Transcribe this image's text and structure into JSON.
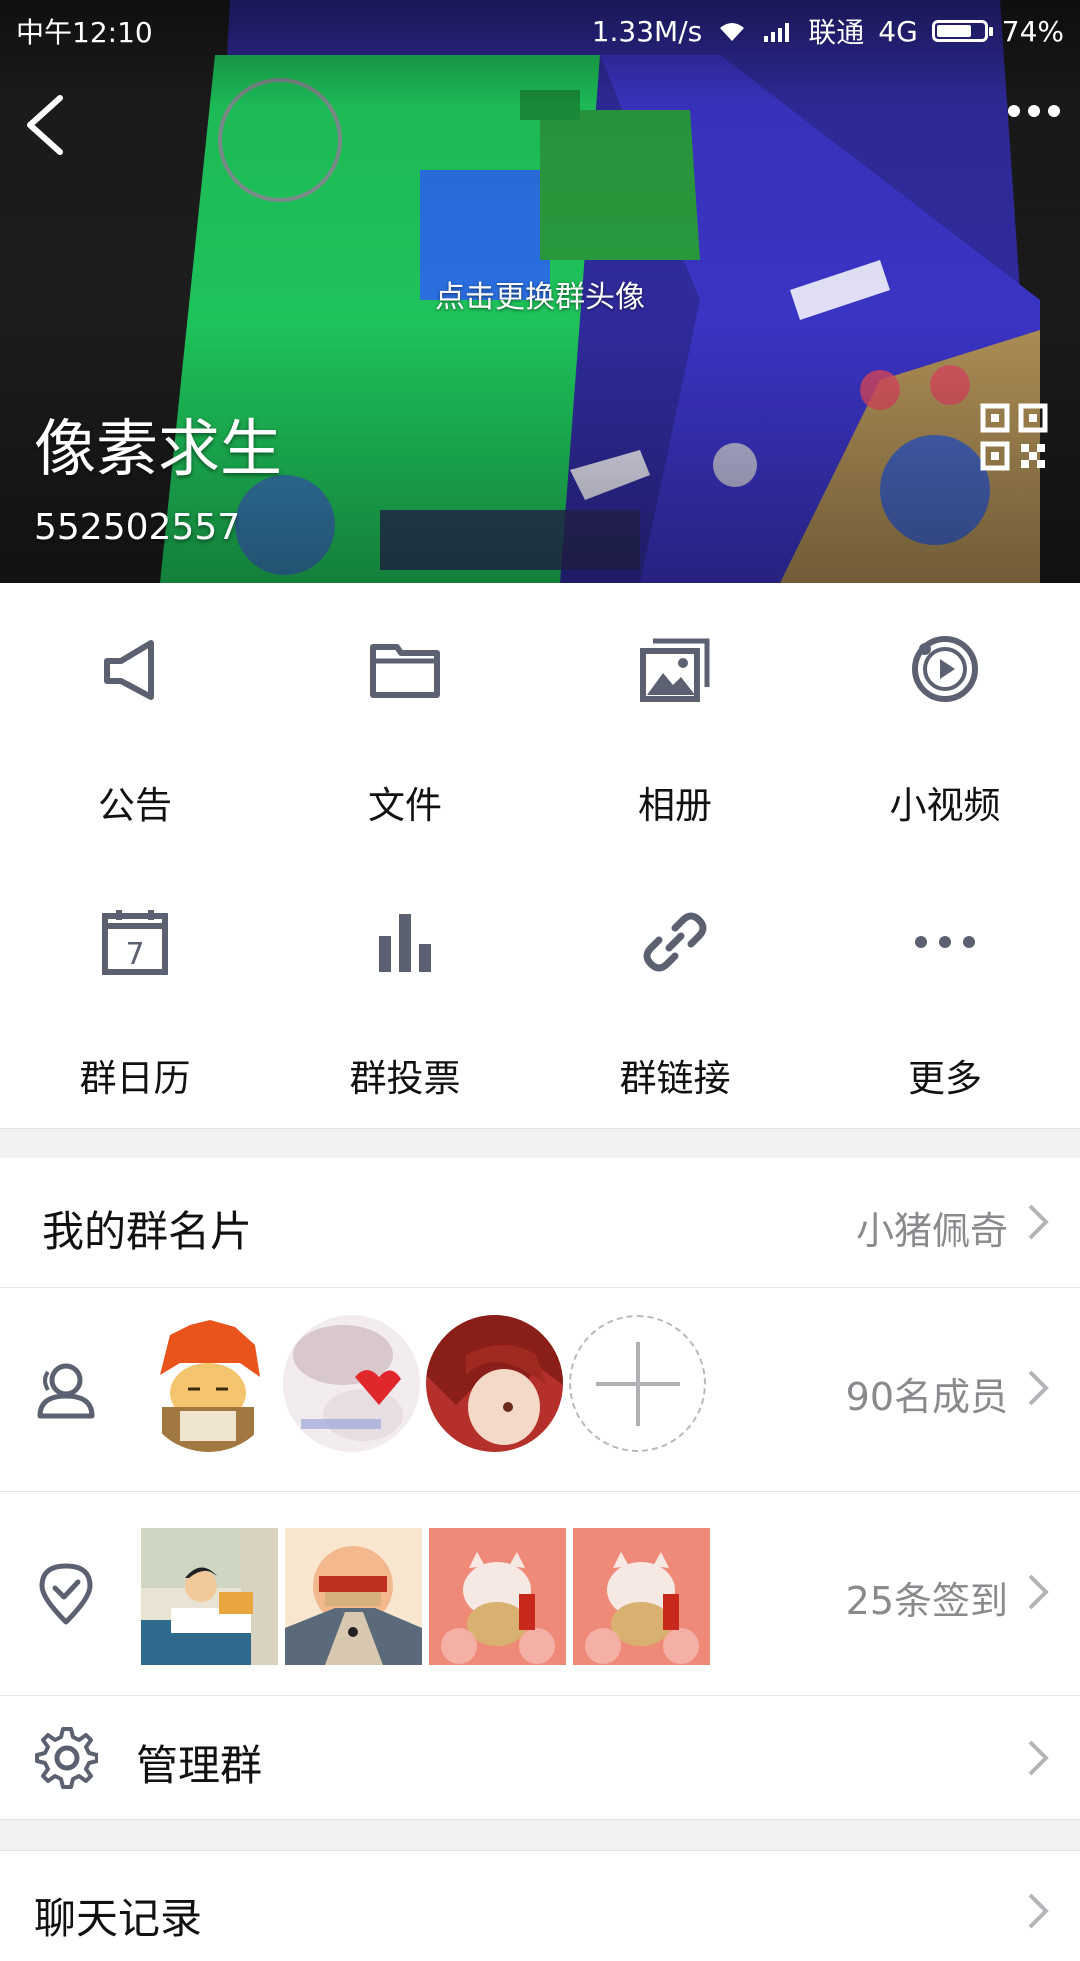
{
  "status_bar": {
    "time": "中午12:10",
    "speed": "1.33M/s",
    "carrier": "联通",
    "network": "4G",
    "battery": "74%",
    "battery_level": 0.74
  },
  "header": {
    "change_avatar_hint": "点击更换群头像",
    "group_name": "像素求生",
    "group_id": "552502557"
  },
  "features": [
    {
      "label": "公告",
      "icon": "megaphone-icon"
    },
    {
      "label": "文件",
      "icon": "folder-icon"
    },
    {
      "label": "相册",
      "icon": "album-icon"
    },
    {
      "label": "小视频",
      "icon": "video-icon"
    },
    {
      "label": "群日历",
      "icon": "calendar-icon",
      "day": "7"
    },
    {
      "label": "群投票",
      "icon": "bar-chart-icon"
    },
    {
      "label": "群链接",
      "icon": "link-icon"
    },
    {
      "label": "更多",
      "icon": "more-icon"
    }
  ],
  "rows": {
    "card": {
      "title": "我的群名片",
      "value": "小猪佩奇"
    },
    "members": {
      "value": "90名成员"
    },
    "checkin": {
      "value": "25条签到"
    },
    "manage": {
      "title": "管理群"
    },
    "chat_history": {
      "title": "聊天记录"
    }
  },
  "colors": {
    "icon": "#5b6170",
    "text": "#111111",
    "secondary": "#8a8a8e",
    "divider": "#e4e4e6"
  }
}
